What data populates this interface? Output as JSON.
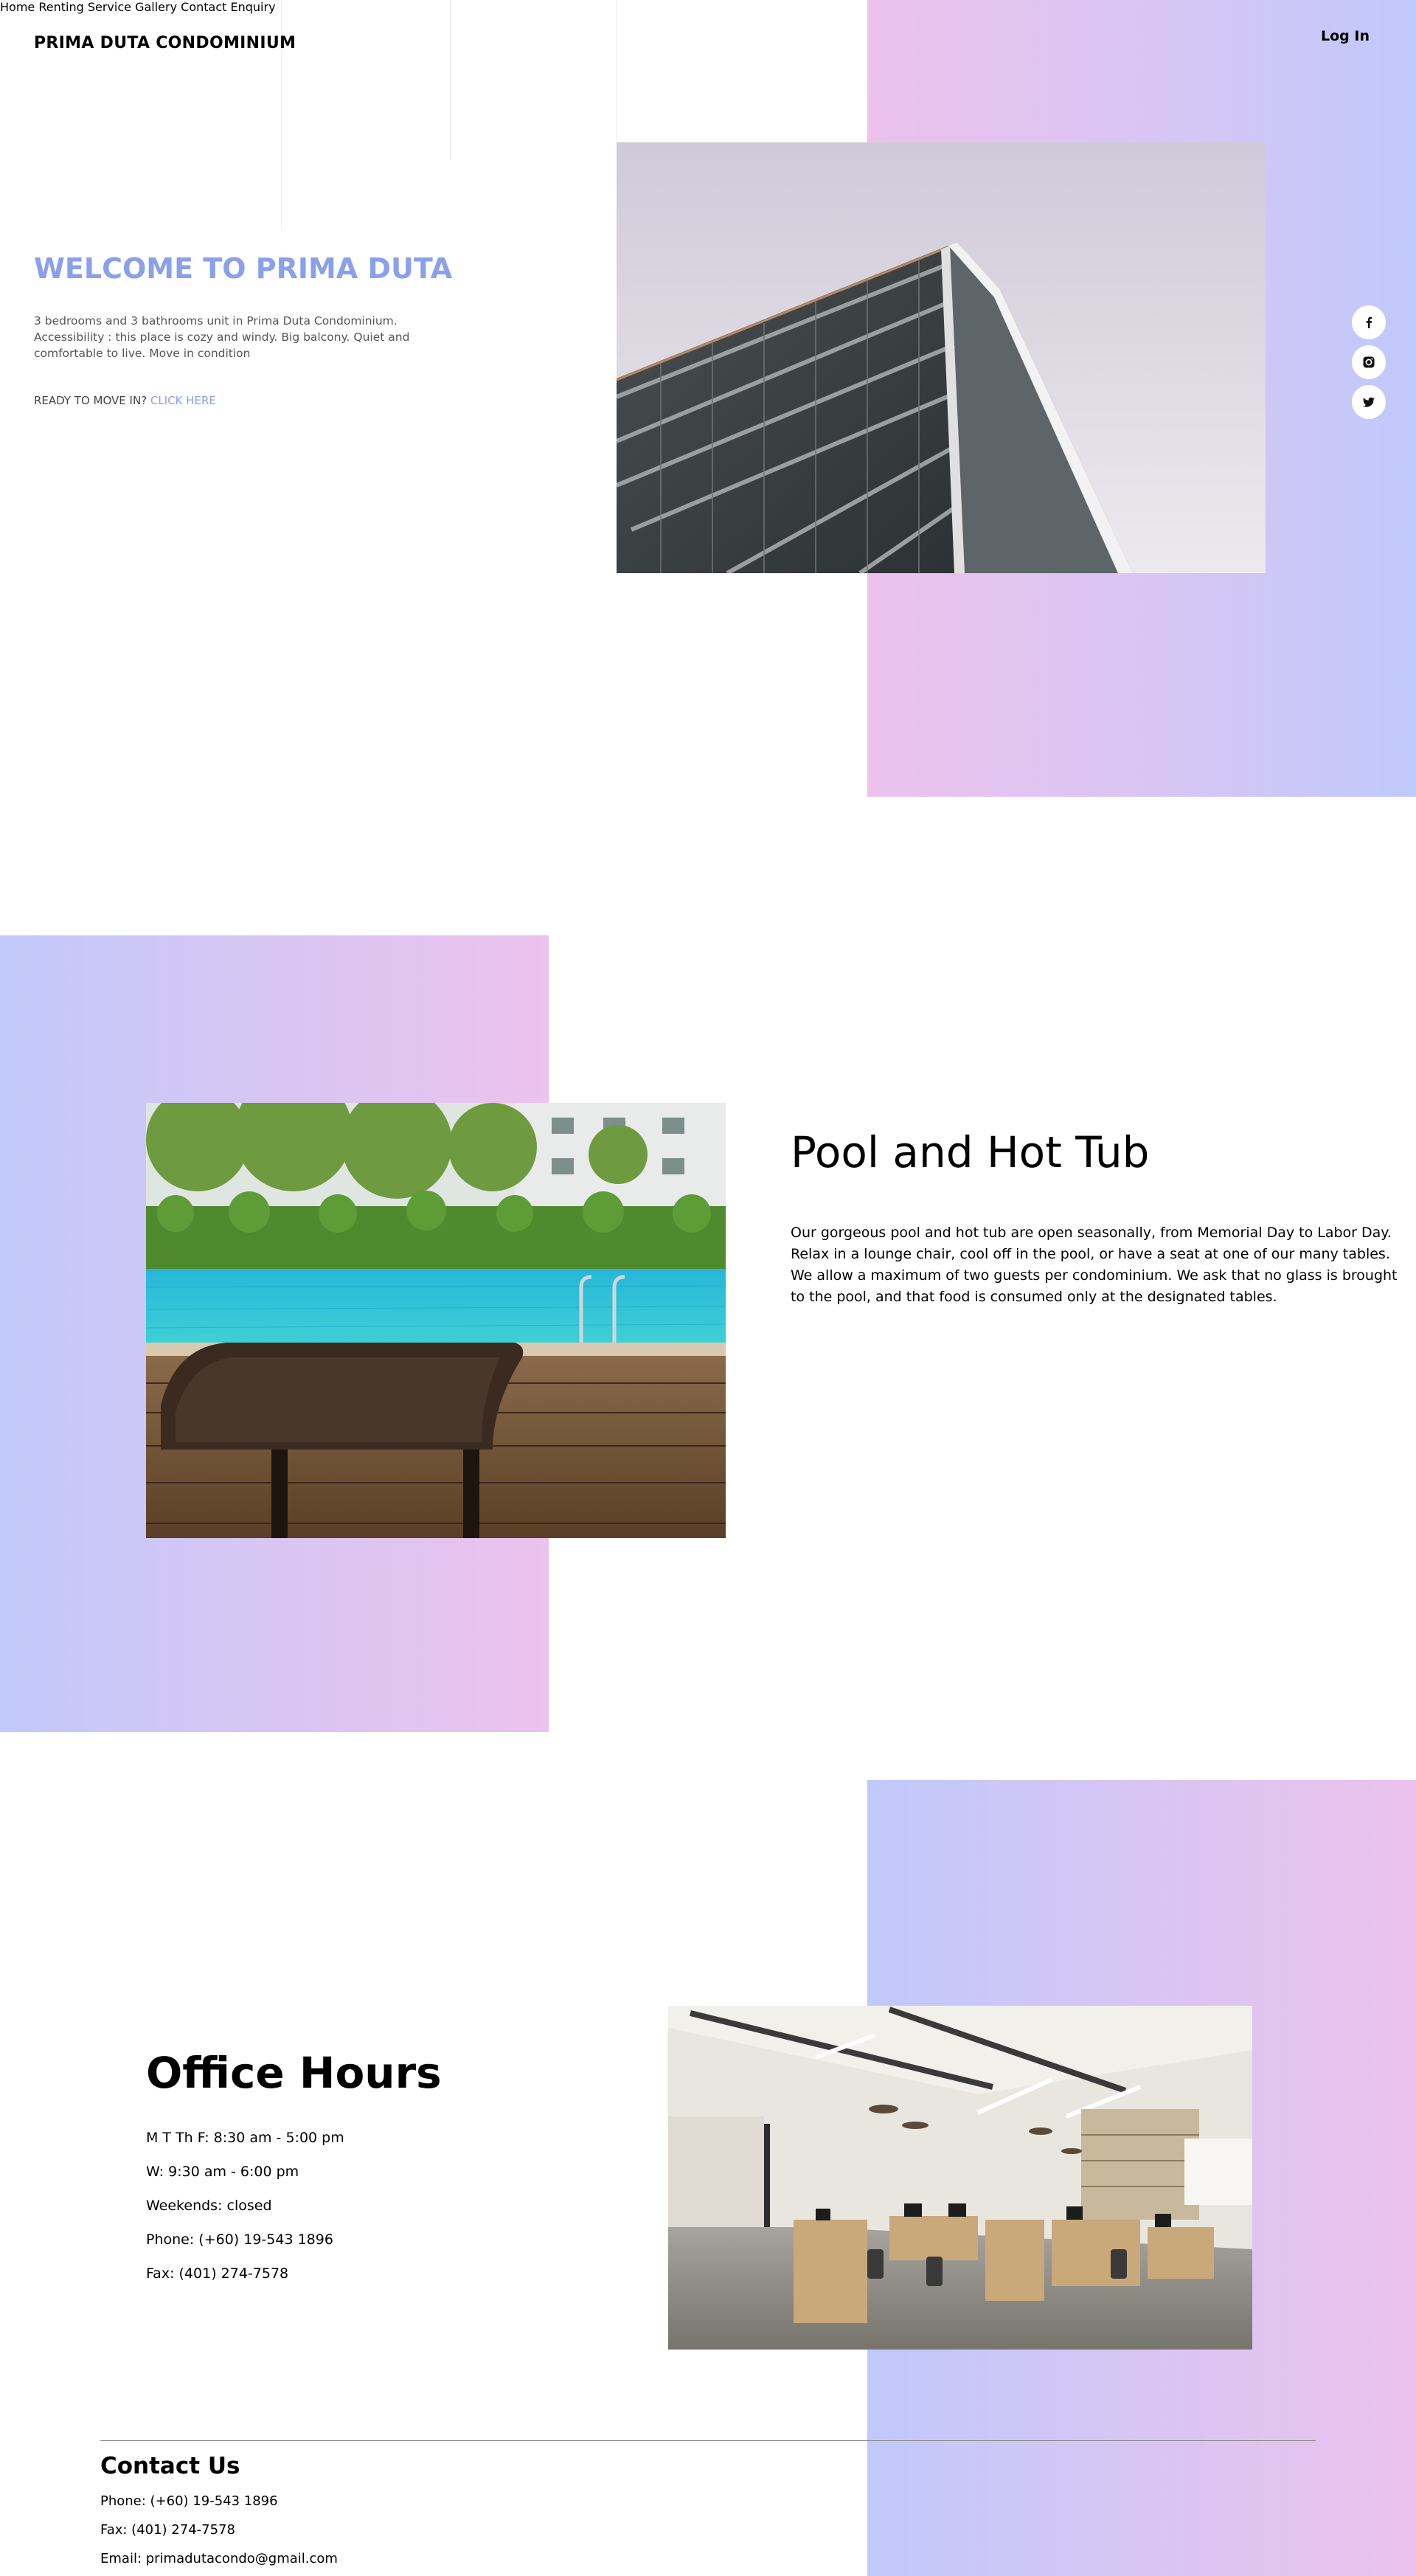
{
  "brand": "PRIMA DUTA CONDOMINIUM",
  "nav": {
    "items": [
      "Home",
      "Renting",
      "Service",
      "Gallery",
      "Contact",
      "Enquiry"
    ],
    "login": "Log In"
  },
  "hero": {
    "title": "WELCOME TO PRIMA DUTA",
    "description": "3 bedrooms and 3 bathrooms unit in Prima Duta Condominium. Accessibility : this place is cozy and windy. Big balcony. Quiet and comfortable to live. Move in condition",
    "cta_prefix": "READY TO MOVE IN? ",
    "cta_link": "CLICK HERE"
  },
  "social": [
    "facebook-icon",
    "instagram-icon",
    "twitter-icon"
  ],
  "pool": {
    "title": "Pool and Hot Tub",
    "text": "Our gorgeous pool and hot tub are open seasonally, from Memorial Day to Labor Day. Relax in a lounge chair, cool off in the pool, or have a seat at one of our many tables. We allow a maximum of two guests per condominium. We ask that no glass is brought to the pool, and that food is consumed only at the designated tables."
  },
  "office": {
    "title": "Office Hours",
    "lines": [
      "M T Th F: 8:30 am - 5:00 pm",
      "W: 9:30 am - 6:00 pm",
      "Weekends: closed",
      "Phone: (+60) 19-543 1896",
      "Fax: (401) 274-7578"
    ]
  },
  "contact": {
    "title": "Contact Us",
    "lines": [
      "Phone: (+60) 19-543 1896",
      "Fax: (401) 274-7578",
      "Email: primadutacondo@gmail.com"
    ]
  },
  "colors": {
    "accent": "#8aa0ec",
    "gradient_pink": "#ecc2ed",
    "gradient_blue": "#c0c9fb"
  }
}
